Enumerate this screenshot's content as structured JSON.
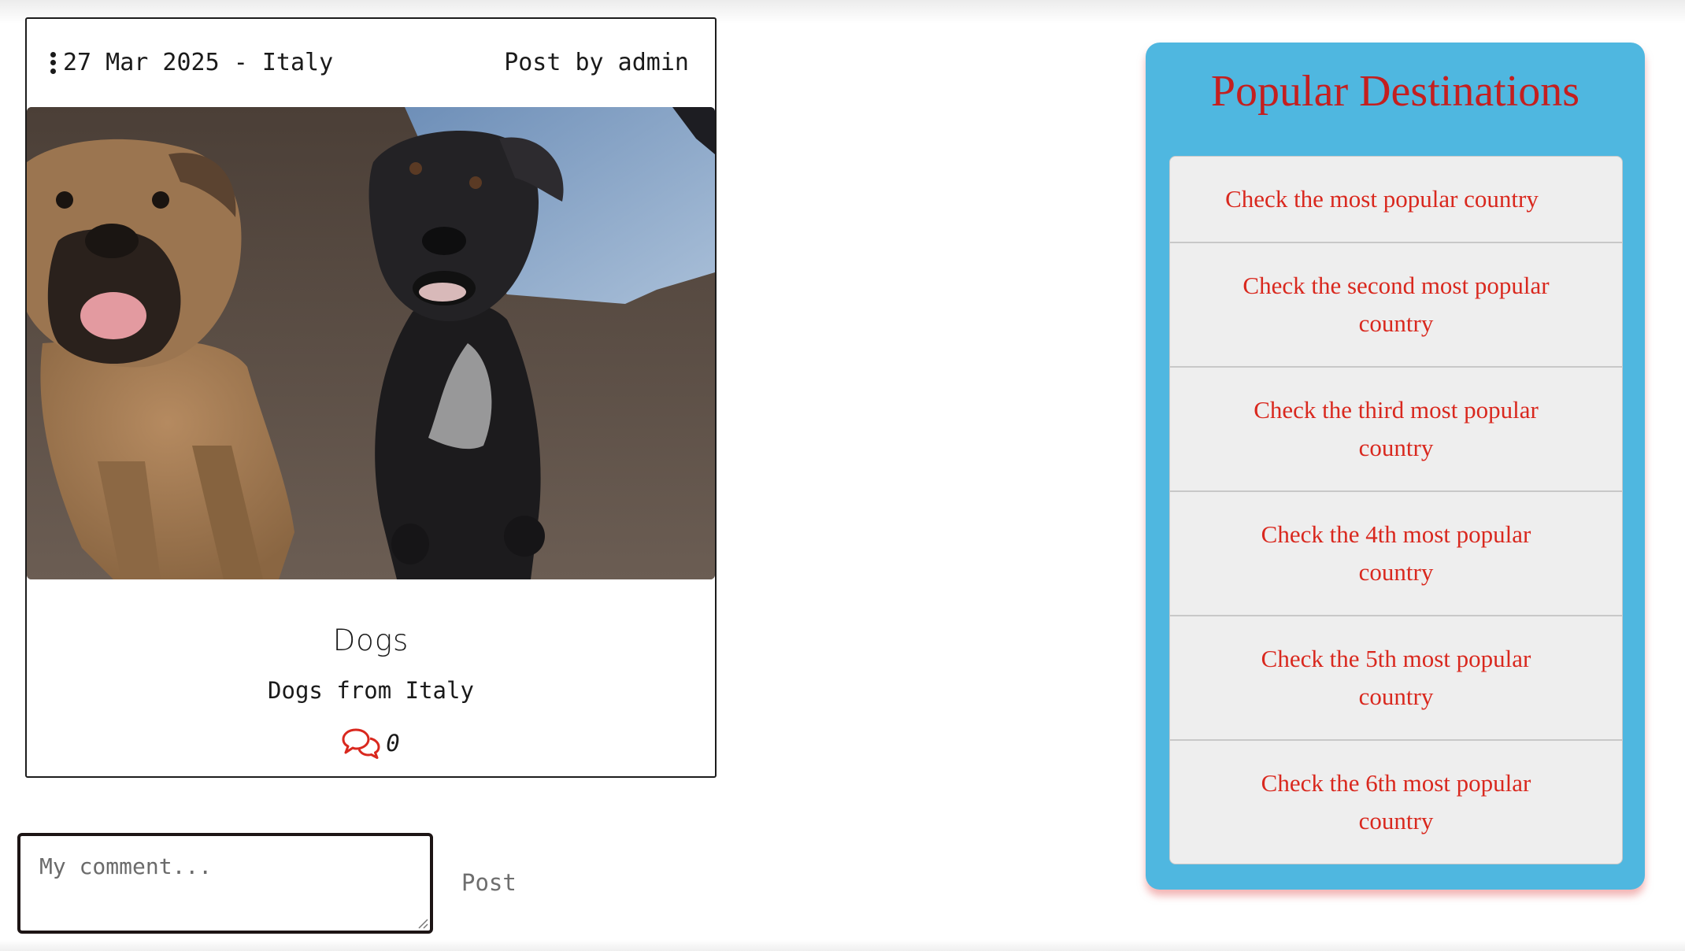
{
  "post": {
    "date_location": "27 Mar 2025 - Italy",
    "author": "Post by admin",
    "title": "Dogs",
    "subtitle": "Dogs from Italy",
    "comment_count": "0"
  },
  "comment_form": {
    "placeholder": "My comment...",
    "post_label": "Post"
  },
  "sidebar": {
    "title": "Popular Destinations",
    "items": [
      {
        "label": "Check the most popular country"
      },
      {
        "label": "Check the second most popular country"
      },
      {
        "label": "Check the third most popular country"
      },
      {
        "label": "Check the 4th most popular country"
      },
      {
        "label": "Check the 5th most popular country"
      },
      {
        "label": "Check the 6th most popular country"
      }
    ]
  },
  "colors": {
    "panel_background": "#4fb7e0",
    "accent_red": "#d9281e",
    "list_background": "#eeeeee"
  },
  "icons": {
    "menu": "kebab-menu-icon",
    "comments": "comments-icon"
  }
}
